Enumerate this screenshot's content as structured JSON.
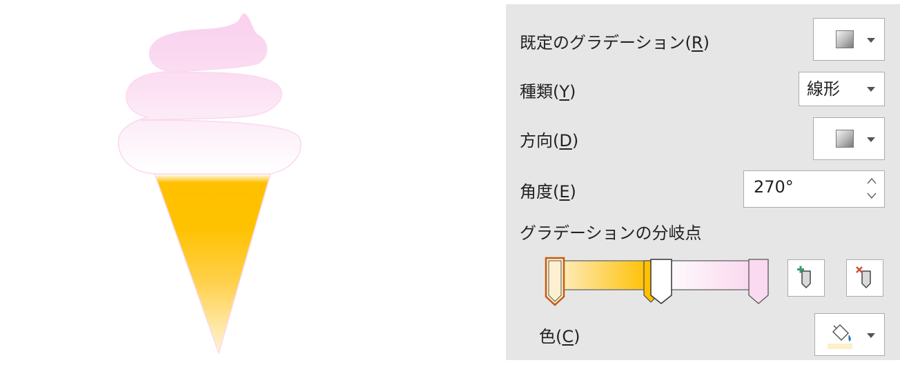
{
  "panel": {
    "preset": {
      "label": "既定のグラデーション(",
      "accel": "R",
      "label_end": ")",
      "icon": "gradient-swatch-icon"
    },
    "type": {
      "label": "種類(",
      "accel": "Y",
      "label_end": ")",
      "value": "線形"
    },
    "direction": {
      "label": "方向(",
      "accel": "D",
      "label_end": ")",
      "icon": "gradient-swatch-icon"
    },
    "angle": {
      "label": "角度(",
      "accel": "E",
      "label_end": ")",
      "value": "270°"
    },
    "stops": {
      "label": "グラデーションの分岐点",
      "colors": [
        "#fdf0d0",
        "#ffc000",
        "#ffffff",
        "#fadaf0"
      ],
      "selected_index": 0,
      "accent": "#c55a11"
    },
    "color": {
      "label": "色(",
      "accel": "C",
      "label_end": ")",
      "icon": "paint-bucket-icon",
      "swatch": "#fdf0c8"
    }
  },
  "colors": {
    "panel_bg": "#e6e6e6",
    "cream_top": "#fad3ef",
    "cream_bottom": "#ffffff",
    "cone_top": "#ffc000",
    "cone_bottom": "#fff3d6"
  }
}
